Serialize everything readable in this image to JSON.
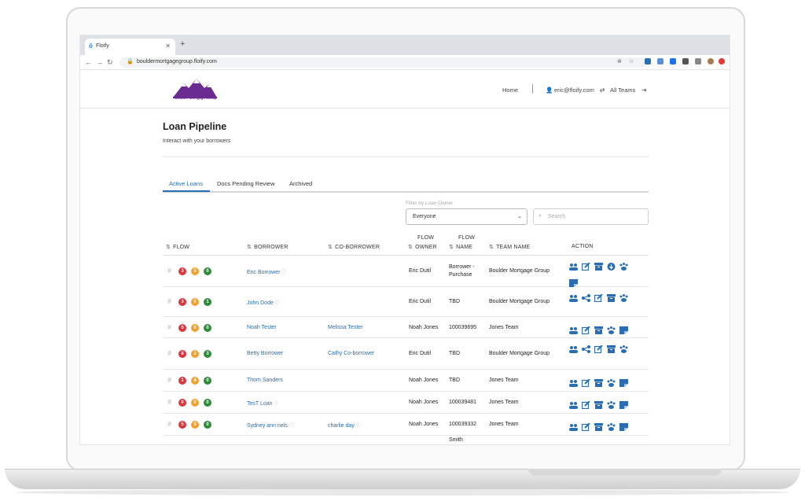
{
  "browser": {
    "tab_title": "Floify",
    "tab_favicon": "ō",
    "url": "bouldermortgagegroup.floify.com"
  },
  "header": {
    "logo_text": "Boulder Mortgage Group",
    "home": "Home",
    "user_email": "eric@floify.com",
    "teams": "All Teams"
  },
  "page": {
    "title": "Loan Pipeline",
    "subtitle": "Interact with your borrowers"
  },
  "tabs": [
    "Active Loans",
    "Docs Pending Review",
    "Archived"
  ],
  "filter": {
    "label": "Filter by Loan Owner",
    "selected": "Everyone",
    "search_placeholder": "Search"
  },
  "columns": {
    "flow": "FLOW",
    "borrower": "BORROWER",
    "coborrower": "CO-BORROWER",
    "flow_owner_1": "FLOW",
    "flow_owner_2": "OWNER",
    "flow_name_1": "FLOW",
    "flow_name_2": "NAME",
    "team": "TEAM NAME",
    "action": "ACTION"
  },
  "rows": [
    {
      "b": [
        "3",
        "5",
        "0"
      ],
      "borrower": "Eric Borrower",
      "coborrower": "",
      "owner": "Eric Dutil",
      "flow_name_1": "Borrower -",
      "flow_name_2": "Purchase",
      "team": "Boulder Mortgage Group"
    },
    {
      "b": [
        "3",
        "0",
        "1"
      ],
      "borrower": "John Dode",
      "coborrower": "",
      "owner": "Eric Dutil",
      "flow_name_1": "TBD",
      "flow_name_2": "",
      "team": "Boulder Mortgage Group"
    },
    {
      "b": [
        "5",
        "6",
        "0"
      ],
      "borrower": "Noah Tester",
      "coborrower": "Melissa Tester",
      "owner": "Noah Jones",
      "flow_name_1": "100039695",
      "flow_name_2": "",
      "team": "Jones Team"
    },
    {
      "b": [
        "8",
        "2",
        "3"
      ],
      "borrower": "Betty Borrower",
      "coborrower": "Cathy Co-borrower",
      "owner": "Eric Dutil",
      "flow_name_1": "TBD",
      "flow_name_2": "",
      "team": "Boulder Mortgage Group"
    },
    {
      "b": [
        "1",
        "4",
        "0"
      ],
      "borrower": "Thom Sanders",
      "coborrower": "",
      "owner": "Noah Jones",
      "flow_name_1": "TBD",
      "flow_name_2": "",
      "team": "Jones Team"
    },
    {
      "b": [
        "0",
        "0",
        "0"
      ],
      "borrower": "TesT Loan",
      "coborrower": "",
      "owner": "Noah Jones",
      "flow_name_1": "100039481",
      "flow_name_2": "",
      "team": "Jones Team"
    },
    {
      "b": [
        "5",
        "0",
        "0"
      ],
      "borrower": "Sydney ann nels",
      "coborrower": "charlie day",
      "owner": "Noah Jones",
      "flow_name_1": "100039332",
      "flow_name_2": "",
      "team": "Jones Team"
    },
    {
      "b": [
        "",
        "",
        ""
      ],
      "borrower": "",
      "coborrower": "",
      "owner": "",
      "flow_name_1": "Smith",
      "flow_name_2": "",
      "team": ""
    }
  ],
  "colors": {
    "accent": "#2a6db0",
    "badge_red": "#d9363e",
    "badge_orange": "#f0a030",
    "badge_green": "#2e8b3a",
    "logo_purple": "#6a2c91"
  }
}
